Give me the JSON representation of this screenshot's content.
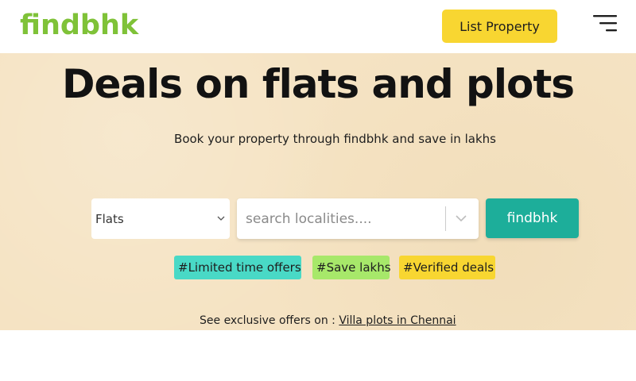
{
  "header": {
    "logo": "findbhk",
    "list_property_label": "List Property",
    "menu_icon": "hamburger-menu-icon"
  },
  "hero": {
    "title": "Deals on flats and plots",
    "subtitle": "Book your property through findbhk and save in lakhs",
    "background_color": "#f5e3c3"
  },
  "search": {
    "property_type_value": "Flats",
    "locality_placeholder": "search localities....",
    "submit_label": "findbhk"
  },
  "tags": [
    {
      "label": "#Limited time offers",
      "color": "#49d9c6"
    },
    {
      "label": "#Save lakhs",
      "color": "#a7e86a"
    },
    {
      "label": "#Verified deals",
      "color": "#f8d631"
    }
  ],
  "offers": {
    "prefix": "See exclusive offers on : ",
    "link_label": "Villa plots in Chennai"
  },
  "colors": {
    "brand_green": "#7fc238",
    "accent_yellow": "#f8d631",
    "button_teal": "#1dae9a"
  }
}
